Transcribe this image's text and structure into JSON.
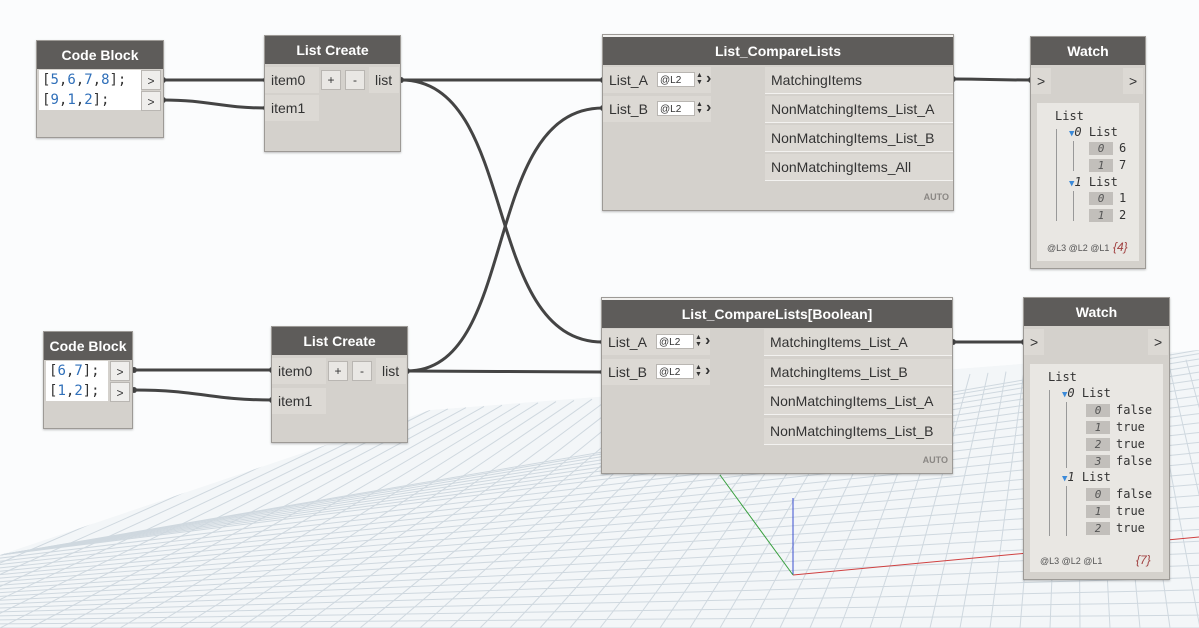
{
  "nodes": {
    "code_block_1": {
      "title": "Code Block",
      "lines": [
        "[5,6,7,8];",
        "[9,1,2];"
      ],
      "out": ">"
    },
    "code_block_2": {
      "title": "Code Block",
      "lines": [
        "[6,7];",
        "[1,2];"
      ],
      "out": ">"
    },
    "list_create_1": {
      "title": "List Create",
      "in": [
        "item0",
        "item1"
      ],
      "out": "list",
      "plus": "+",
      "minus": "-"
    },
    "list_create_2": {
      "title": "List Create",
      "in": [
        "item0",
        "item1"
      ],
      "out": "list",
      "plus": "+",
      "minus": "-"
    },
    "compare_1": {
      "title": "List_CompareLists",
      "in": [
        "List_A",
        "List_B"
      ],
      "levels": [
        "@L2",
        "@L2"
      ],
      "out": [
        "MatchingItems",
        "NonMatchingItems_List_A",
        "NonMatchingItems_List_B",
        "NonMatchingItems_All"
      ],
      "lacing": "AUTO"
    },
    "compare_2": {
      "title": "List_CompareLists[Boolean]",
      "in": [
        "List_A",
        "List_B"
      ],
      "levels": [
        "@L2",
        "@L2"
      ],
      "out": [
        "MatchingItems_List_A",
        "MatchingItems_List_B",
        "NonMatchingItems_List_A",
        "NonMatchingItems_List_B"
      ],
      "lacing": "AUTO"
    },
    "watch_1": {
      "title": "Watch",
      "in": ">",
      "out": ">",
      "root": "List",
      "sub": [
        {
          "label": "0",
          "name": "List",
          "items": [
            {
              "i": "0",
              "v": "6"
            },
            {
              "i": "1",
              "v": "7"
            }
          ]
        },
        {
          "label": "1",
          "name": "List",
          "items": [
            {
              "i": "0",
              "v": "1"
            },
            {
              "i": "1",
              "v": "2"
            }
          ]
        }
      ],
      "footer": "@L3 @L2 @L1",
      "count": "{4}"
    },
    "watch_2": {
      "title": "Watch",
      "in": ">",
      "out": ">",
      "root": "List",
      "sub": [
        {
          "label": "0",
          "name": "List",
          "items": [
            {
              "i": "0",
              "v": "false"
            },
            {
              "i": "1",
              "v": "true"
            },
            {
              "i": "2",
              "v": "true"
            },
            {
              "i": "3",
              "v": "false"
            }
          ]
        },
        {
          "label": "1",
          "name": "List",
          "items": [
            {
              "i": "0",
              "v": "false"
            },
            {
              "i": "1",
              "v": "true"
            },
            {
              "i": "2",
              "v": "true"
            }
          ]
        }
      ],
      "footer": "@L3 @L2 @L1",
      "count": "{7}"
    }
  },
  "colors": {
    "header": "#5e5c5a",
    "node_body": "#d4d1cc",
    "wire": "#444444",
    "number": "#2f6fb9"
  }
}
